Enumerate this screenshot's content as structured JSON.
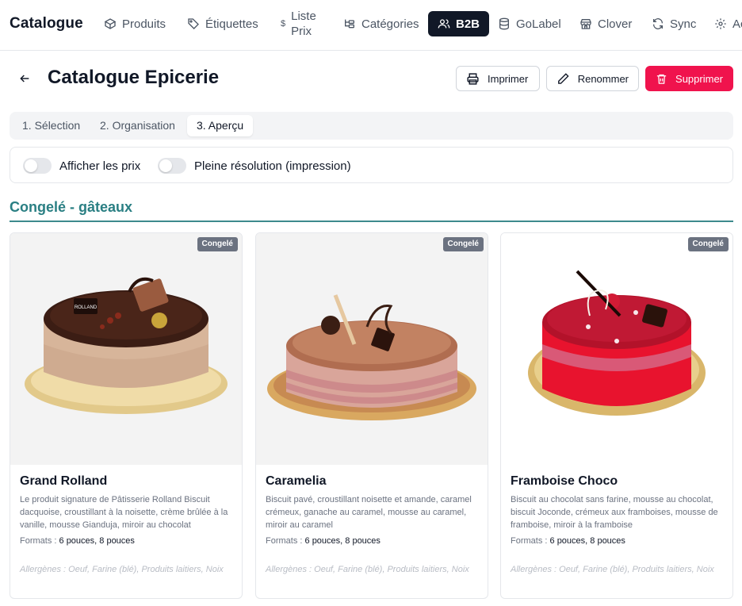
{
  "nav": {
    "brand": "Catalogue",
    "items": [
      {
        "label": "Produits",
        "icon": "box-icon"
      },
      {
        "label": "Étiquettes",
        "icon": "tag-icon"
      },
      {
        "label_line1": "Liste",
        "label_line2": "Prix",
        "icon": "dollar-icon"
      },
      {
        "label": "Catégories",
        "icon": "tree-icon"
      },
      {
        "label": "B2B",
        "icon": "users-icon"
      },
      {
        "label": "GoLabel",
        "icon": "database-icon"
      },
      {
        "label": "Clover",
        "icon": "store-icon"
      },
      {
        "label": "Sync",
        "icon": "refresh-icon"
      },
      {
        "label": "Ac",
        "icon": "gear-icon"
      }
    ]
  },
  "header": {
    "title": "Catalogue Epicerie",
    "print_label": "Imprimer",
    "rename_label": "Renommer",
    "delete_label": "Supprimer"
  },
  "steps": [
    "1. Sélection",
    "2. Organisation",
    "3. Aperçu"
  ],
  "toggles": {
    "show_prices": "Afficher les prix",
    "full_resolution": "Pleine résolution (impression)"
  },
  "section": {
    "title": "Congelé - gâteaux"
  },
  "products": [
    {
      "badge": "Congelé",
      "name": "Grand Rolland",
      "description": "Le produit signature de Pâtisserie Rolland Biscuit dacquoise, croustillant à la noisette, crème brûlée à la vanille, mousse Gianduja, miroir au chocolat",
      "formats_label": "Formats :",
      "formats": "6 pouces, 8 pouces",
      "allergens": "Allergènes : Oeuf, Farine (blé), Produits laitiers, Noix"
    },
    {
      "badge": "Congelé",
      "name": "Caramelia",
      "description": "Biscuit pavé, croustillant noisette et amande, caramel crémeux, ganache au caramel, mousse au caramel, miroir au caramel",
      "formats_label": "Formats :",
      "formats": "6 pouces, 8 pouces",
      "allergens": "Allergènes : Oeuf, Farine (blé), Produits laitiers, Noix"
    },
    {
      "badge": "Congelé",
      "name": "Framboise Choco",
      "description": "Biscuit au chocolat sans farine, mousse au chocolat, biscuit Joconde, crémeux aux framboises, mousse de framboise, miroir à la framboise",
      "formats_label": "Formats :",
      "formats": "6 pouces, 8 pouces",
      "allergens": "Allergènes : Oeuf, Farine (blé), Produits laitiers, Noix"
    }
  ],
  "colors": {
    "accent": "#2a7f83",
    "danger": "#f0134d",
    "nav_active": "#111827"
  }
}
